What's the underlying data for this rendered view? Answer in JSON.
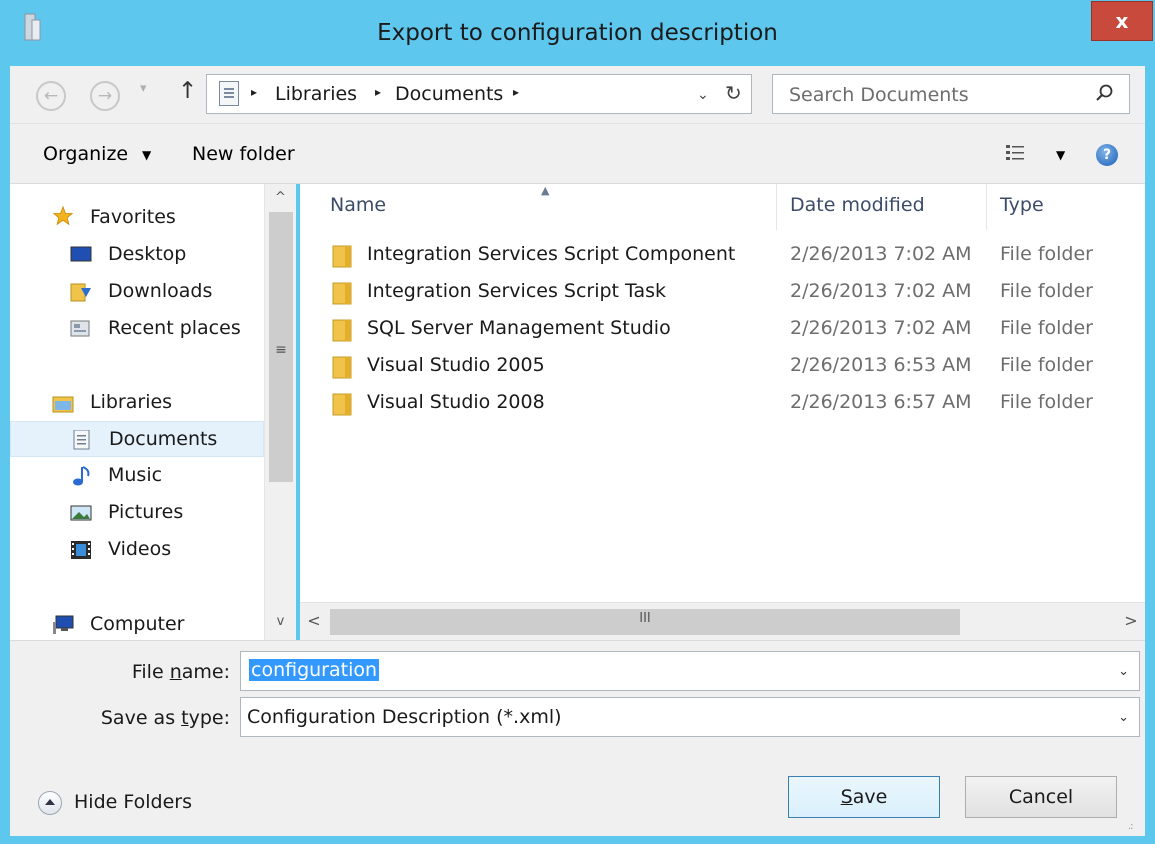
{
  "window": {
    "title": "Export to configuration description",
    "close_label": "x"
  },
  "nav": {
    "back_glyph": "←",
    "forward_glyph": "→",
    "recent_glyph": "▾",
    "up_glyph": "↑",
    "breadcrumb": [
      "Libraries",
      "Documents"
    ],
    "crumb_separator": "▸",
    "address_dropdown_glyph": "⌄",
    "refresh_glyph": "↻",
    "search_placeholder": "Search Documents"
  },
  "toolbar": {
    "organize_label": "Organize",
    "new_folder_label": "New folder",
    "caret": "▼",
    "help_glyph": "?"
  },
  "sidebar": {
    "items": [
      {
        "label": "Favorites",
        "icon": "star-icon"
      },
      {
        "label": "Desktop",
        "icon": "desktop-icon"
      },
      {
        "label": "Downloads",
        "icon": "downloads-icon"
      },
      {
        "label": "Recent places",
        "icon": "recent-places-icon"
      },
      {
        "label": "Libraries",
        "icon": "libraries-icon"
      },
      {
        "label": "Documents",
        "icon": "documents-icon",
        "selected": true
      },
      {
        "label": "Music",
        "icon": "music-icon"
      },
      {
        "label": "Pictures",
        "icon": "pictures-icon"
      },
      {
        "label": "Videos",
        "icon": "videos-icon"
      },
      {
        "label": "Computer",
        "icon": "computer-icon"
      }
    ],
    "scroll_up_glyph": "^",
    "scroll_down_glyph": "v",
    "scroll_grip_glyph": "≡"
  },
  "filelist": {
    "columns": {
      "name": "Name",
      "date": "Date modified",
      "type": "Type"
    },
    "sort_glyph": "▲",
    "rows": [
      {
        "name": "Integration Services Script Component",
        "date": "2/26/2013 7:02 AM",
        "type": "File folder"
      },
      {
        "name": "Integration Services Script Task",
        "date": "2/26/2013 7:02 AM",
        "type": "File folder"
      },
      {
        "name": "SQL Server Management Studio",
        "date": "2/26/2013 7:02 AM",
        "type": "File folder"
      },
      {
        "name": "Visual Studio 2005",
        "date": "2/26/2013 6:53 AM",
        "type": "File folder"
      },
      {
        "name": "Visual Studio 2008",
        "date": "2/26/2013 6:57 AM",
        "type": "File folder"
      }
    ],
    "hscroll_left_glyph": "<",
    "hscroll_right_glyph": ">",
    "hscroll_grip_glyph": "III"
  },
  "form": {
    "file_name_label_pre": "File ",
    "file_name_label_u": "n",
    "file_name_label_post": "ame:",
    "file_name_value": "configuration",
    "save_type_label_pre": "Save as ",
    "save_type_label_u": "t",
    "save_type_label_post": "ype:",
    "save_type_value": "Configuration Description (*.xml)",
    "chevron_glyph": "⌄"
  },
  "footer": {
    "hide_folders_label": "Hide Folders",
    "save_u": "S",
    "save_rest": "ave",
    "cancel_label": "Cancel",
    "resize_glyph": ".:"
  },
  "colors": {
    "titlebar": "#5ec7ee",
    "close": "#c74a3d",
    "selection": "#3399ff",
    "nav_selected": "#e5f1fb",
    "folder": "#f0c34a"
  }
}
